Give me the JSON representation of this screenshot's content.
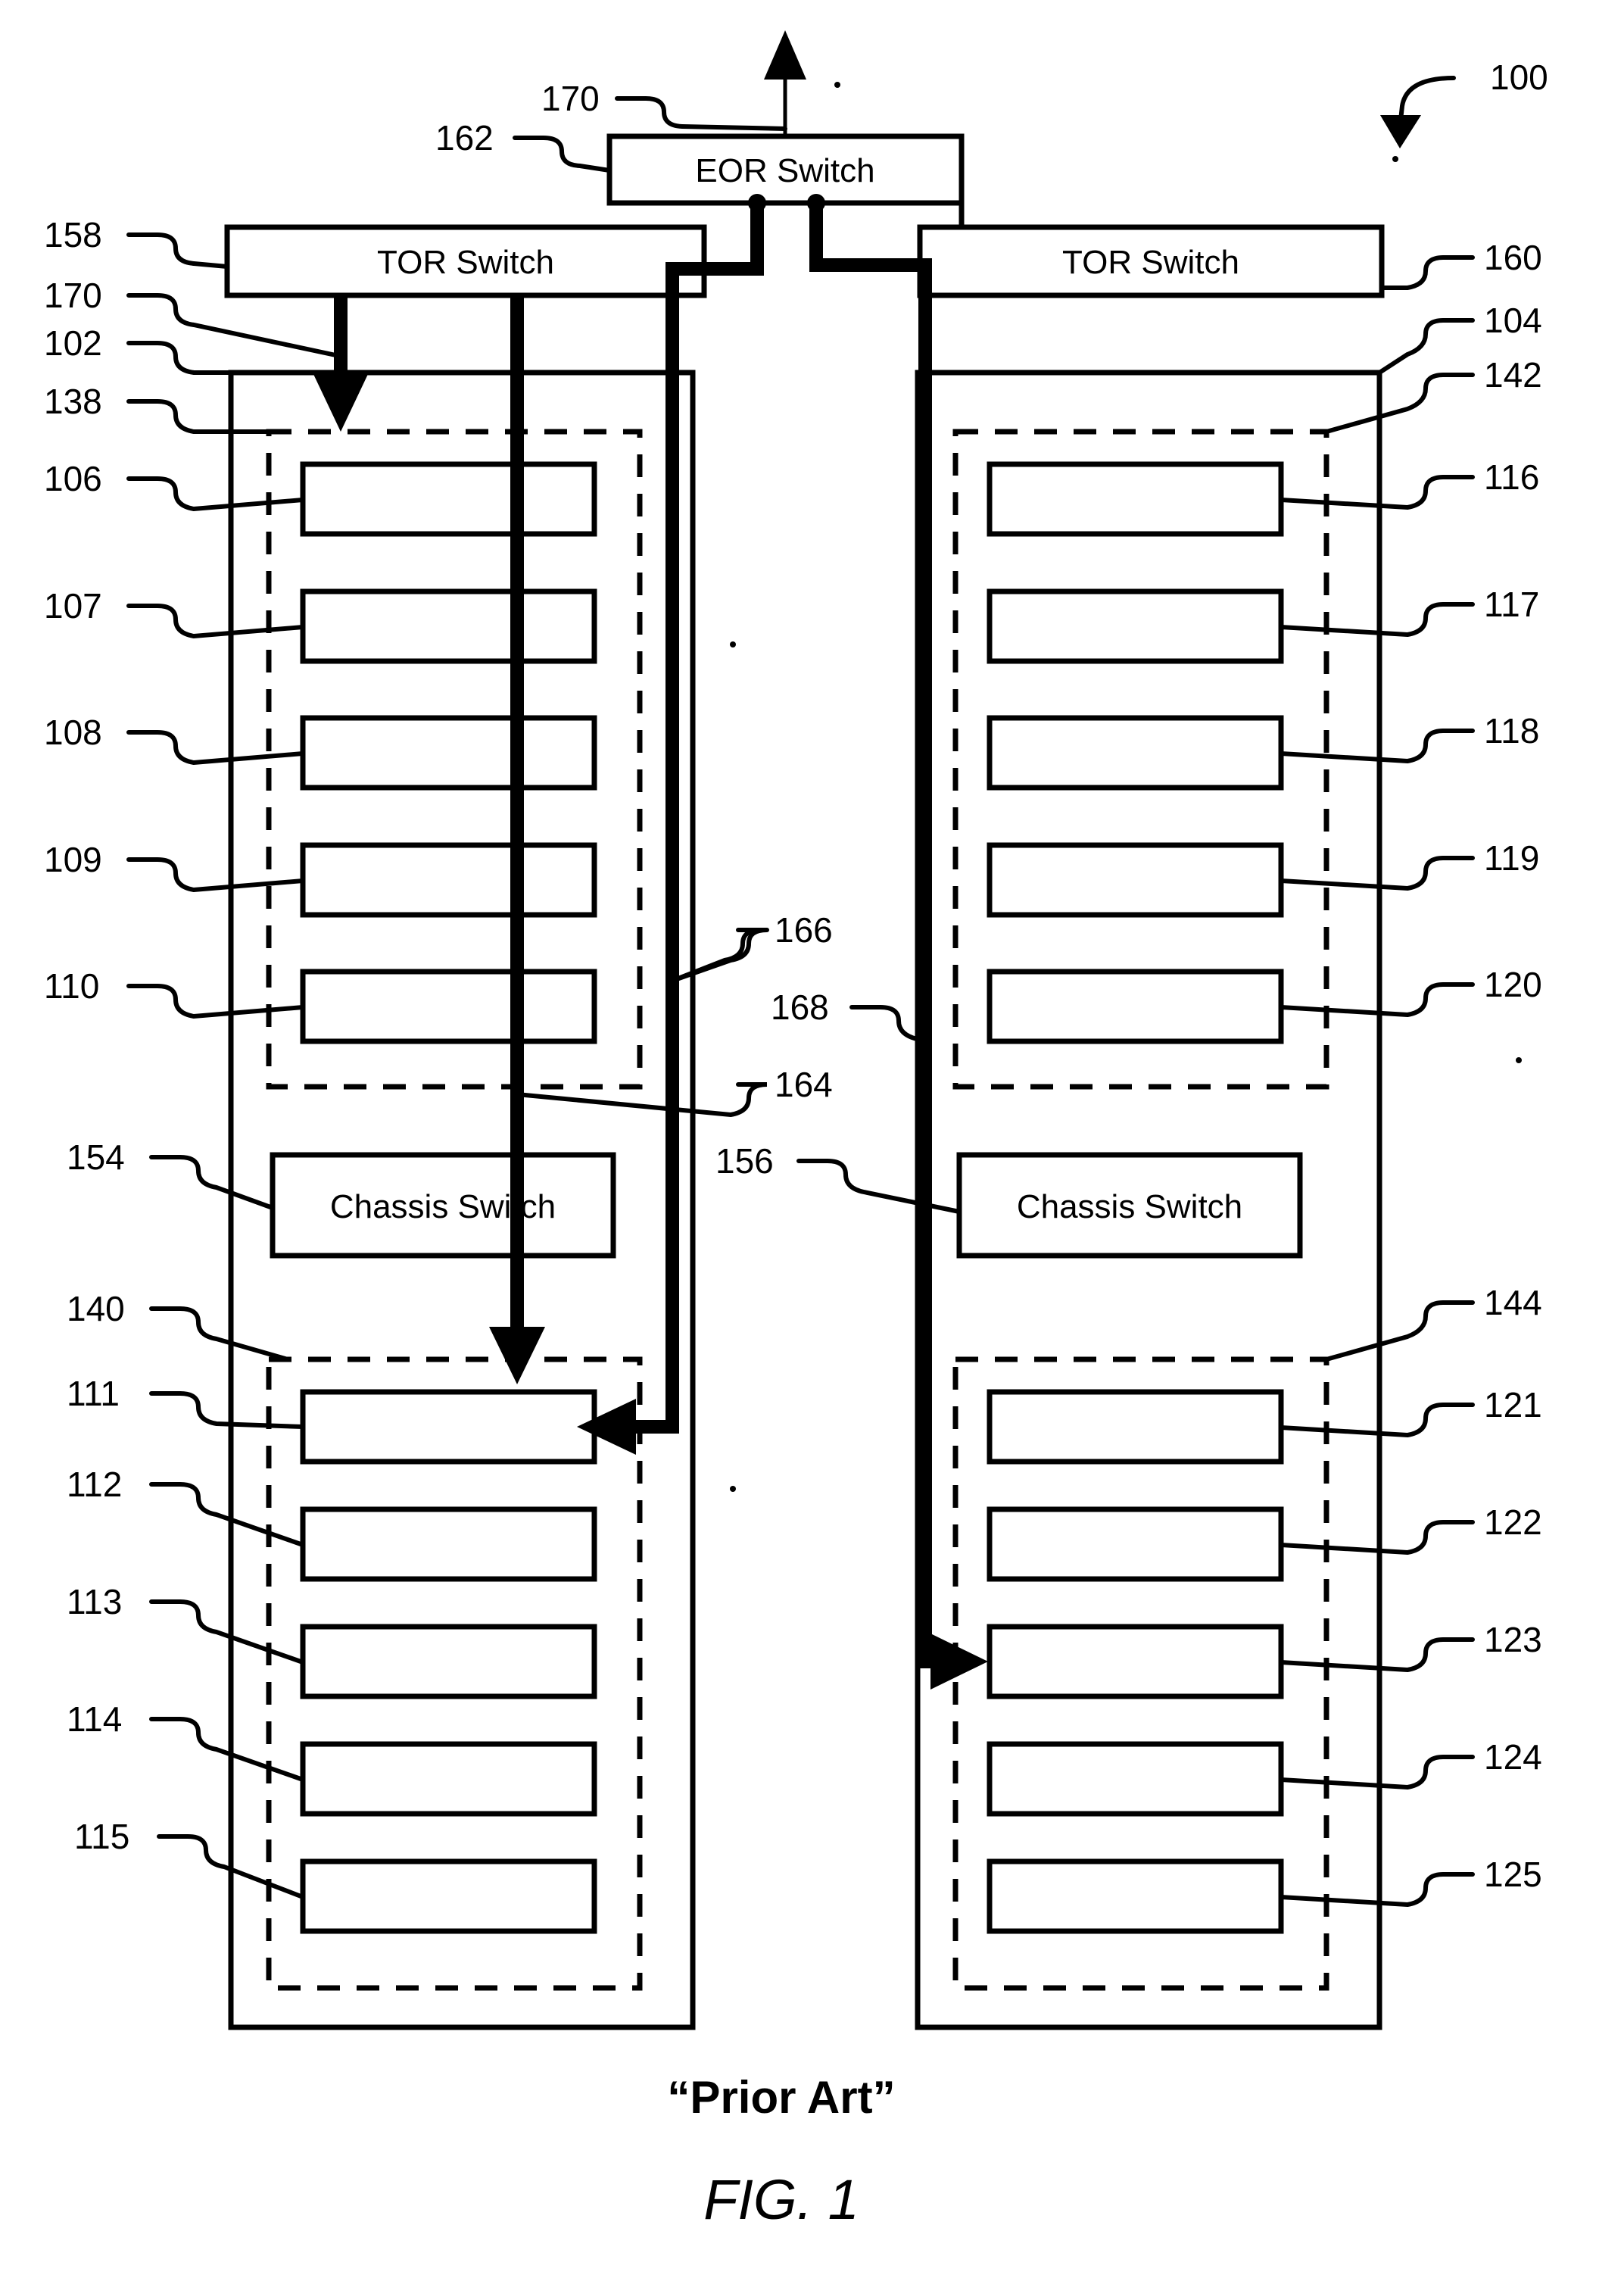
{
  "figure": {
    "caption_prior_art": "“Prior Art”",
    "caption_figure": "FIG. 1",
    "system_ref": "100"
  },
  "switches": {
    "eor": {
      "label": "EOR Switch",
      "ref": "162",
      "uplink_ref": "170"
    },
    "tor_left": {
      "label": "TOR Switch",
      "ref": "158",
      "link_ref": "170"
    },
    "tor_right": {
      "label": "TOR Switch",
      "ref": "160"
    },
    "chassis_left": {
      "label": "Chassis Switch",
      "ref": "154"
    },
    "chassis_right": {
      "label": "Chassis Switch",
      "ref": "156"
    }
  },
  "racks": {
    "left": {
      "ref": "102",
      "groups": [
        {
          "ref": "138",
          "servers": [
            {
              "ref": "106"
            },
            {
              "ref": "107"
            },
            {
              "ref": "108"
            },
            {
              "ref": "109"
            },
            {
              "ref": "110"
            }
          ]
        },
        {
          "ref": "140",
          "servers": [
            {
              "ref": "111"
            },
            {
              "ref": "112"
            },
            {
              "ref": "113"
            },
            {
              "ref": "114"
            },
            {
              "ref": "115"
            }
          ]
        }
      ]
    },
    "right": {
      "ref": "104",
      "groups": [
        {
          "ref": "142",
          "servers": [
            {
              "ref": "116"
            },
            {
              "ref": "117"
            },
            {
              "ref": "118"
            },
            {
              "ref": "119"
            },
            {
              "ref": "120"
            }
          ]
        },
        {
          "ref": "144",
          "servers": [
            {
              "ref": "121"
            },
            {
              "ref": "122"
            },
            {
              "ref": "123"
            },
            {
              "ref": "124"
            },
            {
              "ref": "125"
            }
          ]
        }
      ]
    }
  },
  "links": {
    "intra_rack_chassis": "164",
    "intra_rack_eor": "166",
    "inter_rack_eor": "168"
  },
  "colors": {
    "ink": "#000000",
    "paper": "#ffffff"
  }
}
